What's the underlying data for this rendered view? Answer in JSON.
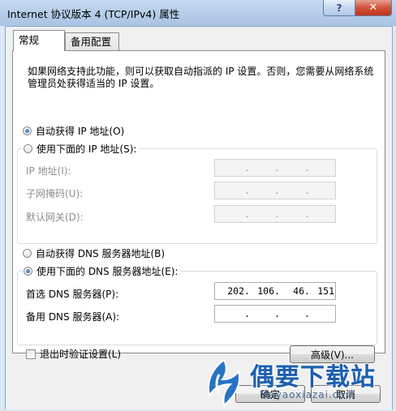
{
  "window": {
    "title": "Internet 协议版本 4 (TCP/IPv4) 属性",
    "help_label": "?",
    "close_label": "✕"
  },
  "tabs": [
    {
      "label": "常规",
      "active": true
    },
    {
      "label": "备用配置",
      "active": false
    }
  ],
  "description": "如果网络支持此功能，则可以获取自动指派的 IP 设置。否则，您需要从网络系统管理员处获得适当的 IP 设置。",
  "ip_section": {
    "auto_label": "自动获得 IP 地址(O)",
    "manual_label": "使用下面的 IP 地址(S):",
    "selected": "auto",
    "fields": [
      {
        "label": "IP 地址(I):",
        "value": [
          "",
          "",
          "",
          ""
        ]
      },
      {
        "label": "子网掩码(U):",
        "value": [
          "",
          "",
          "",
          ""
        ]
      },
      {
        "label": "默认网关(D):",
        "value": [
          "",
          "",
          "",
          ""
        ]
      }
    ]
  },
  "dns_section": {
    "auto_label": "自动获得 DNS 服务器地址(B)",
    "manual_label": "使用下面的 DNS 服务器地址(E):",
    "selected": "manual",
    "fields": [
      {
        "label": "首选 DNS 服务器(P):",
        "value": [
          "202",
          "106",
          "46",
          "151"
        ]
      },
      {
        "label": "备用 DNS 服务器(A):",
        "value": [
          "",
          "",
          "",
          ""
        ]
      }
    ]
  },
  "validate_checkbox": {
    "label": "退出时验证设置(L)",
    "checked": false
  },
  "advanced_button": "高级(V)...",
  "ok_button": "确定",
  "cancel_button": "取消",
  "watermark": {
    "text": "偶要下载站",
    "url": "Mayaoxiazai.com"
  }
}
